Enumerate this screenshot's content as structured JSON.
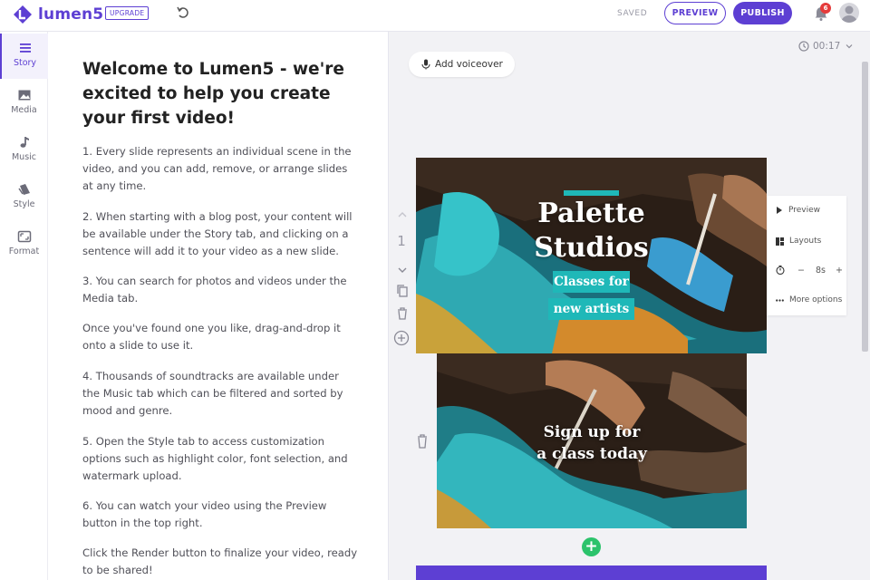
{
  "app": {
    "name": "lumen5",
    "upgrade_label": "UPGRADE",
    "saved_label": "SAVED",
    "preview_label": "PREVIEW",
    "publish_label": "PUBLISH",
    "notification_count": "6",
    "brand_color": "#5d3fd3"
  },
  "sidebar": {
    "items": [
      {
        "label": "Story",
        "icon": "list-icon",
        "active": true
      },
      {
        "label": "Media",
        "icon": "image-icon",
        "active": false
      },
      {
        "label": "Music",
        "icon": "music-note-icon",
        "active": false
      },
      {
        "label": "Style",
        "icon": "palette-icon",
        "active": false
      },
      {
        "label": "Format",
        "icon": "aspect-ratio-icon",
        "active": false
      }
    ]
  },
  "story": {
    "title": "Welcome to Lumen5 - we're excited to help you create your first video!",
    "paragraphs": [
      "1. Every slide represents an individual scene in the video, and you can add, remove, or arrange slides at any time.",
      "2. When starting with a blog post, your content will be available under the Story tab, and clicking on a sentence will add it to your video as a new slide.",
      "3. You can search for photos and videos under the Media tab.",
      "Once you've found one you like, drag-and-drop it onto a slide to use it.",
      "4. Thousands of soundtracks are available under the Music tab which can be filtered and sorted by mood and genre.",
      "5. Open the Style tab to access customization options such as highlight color, font selection, and watermark upload.",
      "6. You can watch your video using the Preview button in the top right.",
      "Click the Render button to finalize your video, ready to be shared!"
    ]
  },
  "canvas": {
    "duration": "00:17",
    "voiceover_label": "Add voiceover",
    "slides": [
      {
        "number": "1",
        "title_line1": "Palette",
        "title_line2": "Studios",
        "highlight_line1": "Classes for",
        "highlight_line2": "new artists"
      },
      {
        "line1": "Sign up for",
        "line2": "a class today"
      }
    ],
    "menu": {
      "preview_label": "Preview",
      "layouts_label": "Layouts",
      "minus": "−",
      "duration_value": "8s",
      "plus": "+",
      "more_label": "More options"
    },
    "add_slide_symbol": "+",
    "accent_color": "#1fb8b8"
  }
}
